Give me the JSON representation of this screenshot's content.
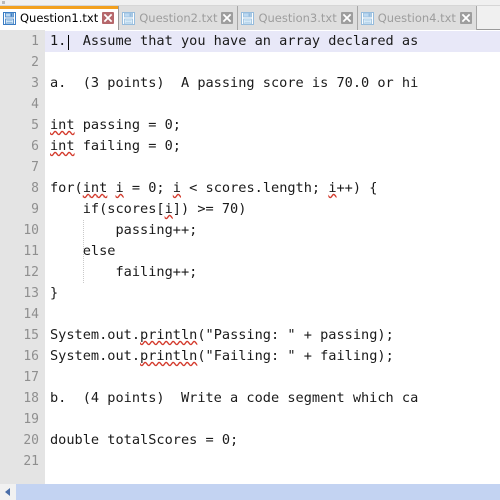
{
  "window": {
    "title": "Question1.txt"
  },
  "tabs": [
    {
      "label": "Question1.txt",
      "icon": "floppy-disk-icon",
      "close_icon": "close-icon",
      "active": true
    },
    {
      "label": "Question2.txt",
      "icon": "floppy-disk-icon",
      "close_icon": "close-icon",
      "active": false
    },
    {
      "label": "Question3.txt",
      "icon": "floppy-disk-icon",
      "close_icon": "close-icon",
      "active": false
    },
    {
      "label": "Question4.txt",
      "icon": "floppy-disk-icon",
      "close_icon": "close-icon",
      "active": false
    }
  ],
  "colors": {
    "active_tab_accent": "#f2a01e",
    "active_close": "#b5676b",
    "inactive_close": "#9d9d9d",
    "gutter_bg": "#e4e4e4",
    "gutter_text": "#8f8f8f",
    "current_line_bg": "#e8e8f8",
    "scrollbar": "#c3d3f2",
    "spellcheck_underline": "#d33a2c",
    "tab_icon": "#3b7dc4"
  },
  "editor": {
    "line_numbers": [
      "1",
      "2",
      "3",
      "4",
      "5",
      "6",
      "7",
      "8",
      "9",
      "10",
      "11",
      "12",
      "13",
      "14",
      "15",
      "16",
      "17",
      "18",
      "19",
      "20",
      "21"
    ],
    "current_line": 1,
    "lines": [
      {
        "n": 1,
        "text": "1.  Assume that you have an array declared as"
      },
      {
        "n": 2,
        "text": ""
      },
      {
        "n": 3,
        "text": "a.  (3 points)  A passing score is 70.0 or hi"
      },
      {
        "n": 4,
        "text": ""
      },
      {
        "n": 5,
        "text": "int passing = 0;"
      },
      {
        "n": 6,
        "text": "int failing = 0;"
      },
      {
        "n": 7,
        "text": ""
      },
      {
        "n": 8,
        "text": "for(int i = 0; i < scores.length; i++) {"
      },
      {
        "n": 9,
        "text": "    if(scores[i]) >= 70)"
      },
      {
        "n": 10,
        "text": "        passing++;"
      },
      {
        "n": 11,
        "text": "    else"
      },
      {
        "n": 12,
        "text": "        failing++;"
      },
      {
        "n": 13,
        "text": "}"
      },
      {
        "n": 14,
        "text": ""
      },
      {
        "n": 15,
        "text": "System.out.println(\"Passing: \" + passing);"
      },
      {
        "n": 16,
        "text": "System.out.println(\"Failing: \" + failing);"
      },
      {
        "n": 17,
        "text": ""
      },
      {
        "n": 18,
        "text": "b.  (4 points)  Write a code segment which ca"
      },
      {
        "n": 19,
        "text": ""
      },
      {
        "n": 20,
        "text": "double totalScores = 0;"
      },
      {
        "n": 21,
        "text": ""
      }
    ],
    "spellcheck_words": [
      "int",
      "i",
      "println"
    ]
  },
  "scrollbar": {
    "left_arrow_icon": "arrow-left-icon",
    "orientation": "horizontal"
  }
}
